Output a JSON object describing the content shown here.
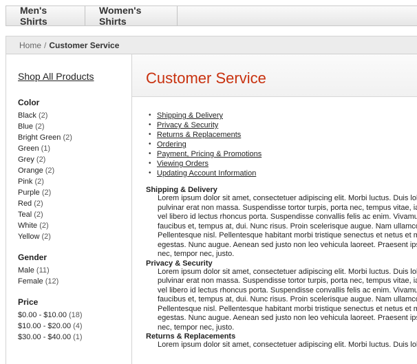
{
  "topnav": {
    "tabs": [
      "Men's Shirts",
      "Women's Shirts"
    ]
  },
  "breadcrumb": {
    "home": "Home",
    "separator": "/",
    "current": "Customer Service"
  },
  "sidebar": {
    "shop_all": "Shop All Products",
    "facets": [
      {
        "title": "Color",
        "items": [
          {
            "label": "Black",
            "count": "(2)"
          },
          {
            "label": "Blue",
            "count": "(2)"
          },
          {
            "label": "Bright Green",
            "count": "(2)"
          },
          {
            "label": "Green",
            "count": "(1)"
          },
          {
            "label": "Grey",
            "count": "(2)"
          },
          {
            "label": "Orange",
            "count": "(2)"
          },
          {
            "label": "Pink",
            "count": "(2)"
          },
          {
            "label": "Purple",
            "count": "(2)"
          },
          {
            "label": "Red",
            "count": "(2)"
          },
          {
            "label": "Teal",
            "count": "(2)"
          },
          {
            "label": "White",
            "count": "(2)"
          },
          {
            "label": "Yellow",
            "count": "(2)"
          }
        ]
      },
      {
        "title": "Gender",
        "items": [
          {
            "label": "Male",
            "count": "(11)"
          },
          {
            "label": "Female",
            "count": "(12)"
          }
        ]
      },
      {
        "title": "Price",
        "items": [
          {
            "label": "$0.00 - $10.00",
            "count": "(18)"
          },
          {
            "label": "$10.00 - $20.00",
            "count": "(4)"
          },
          {
            "label": "$30.00 - $40.00",
            "count": "(1)"
          }
        ]
      }
    ]
  },
  "main": {
    "title": "Customer Service",
    "toc": [
      "Shipping & Delivery",
      "Privacy & Security",
      "Returns & Replacements",
      "Ordering",
      "Payment, Pricing & Promotions",
      "Viewing Orders",
      "Updating Account Information"
    ],
    "sections": [
      {
        "title": "Shipping & Delivery",
        "lines": [
          "Lorem ipsum dolor sit amet, consectetuer adipiscing elit. Morbi luctus. Duis lob",
          "pulvinar erat non massa. Suspendisse tortor turpis, porta nec, tempus vitae, ia",
          "vel libero id lectus rhoncus porta. Suspendisse convallis felis ac enim. Vivamu",
          "faucibus et, tempus at, dui. Nunc risus. Proin scelerisque augue. Nam ullamco",
          "Pellentesque nisl. Pellentesque habitant morbi tristique senectus et netus et ma",
          "egestas. Nunc augue. Aenean sed justo non leo vehicula laoreet. Praesent ips",
          "nec, tempor nec, justo."
        ]
      },
      {
        "title": "Privacy & Security",
        "lines": [
          "Lorem ipsum dolor sit amet, consectetuer adipiscing elit. Morbi luctus. Duis lob",
          "pulvinar erat non massa. Suspendisse tortor turpis, porta nec, tempus vitae, ia",
          "vel libero id lectus rhoncus porta. Suspendisse convallis felis ac enim. Vivamu",
          "faucibus et, tempus at, dui. Nunc risus. Proin scelerisque augue. Nam ullamco",
          "Pellentesque nisl. Pellentesque habitant morbi tristique senectus et netus et ma",
          "egestas. Nunc augue. Aenean sed justo non leo vehicula laoreet. Praesent ips",
          "nec, tempor nec, justo."
        ]
      },
      {
        "title": "Returns & Replacements",
        "lines": [
          "Lorem ipsum dolor sit amet, consectetuer adipiscing elit. Morbi luctus. Duis lob"
        ]
      }
    ]
  },
  "colors": {
    "title_accent": "#c8310e"
  }
}
